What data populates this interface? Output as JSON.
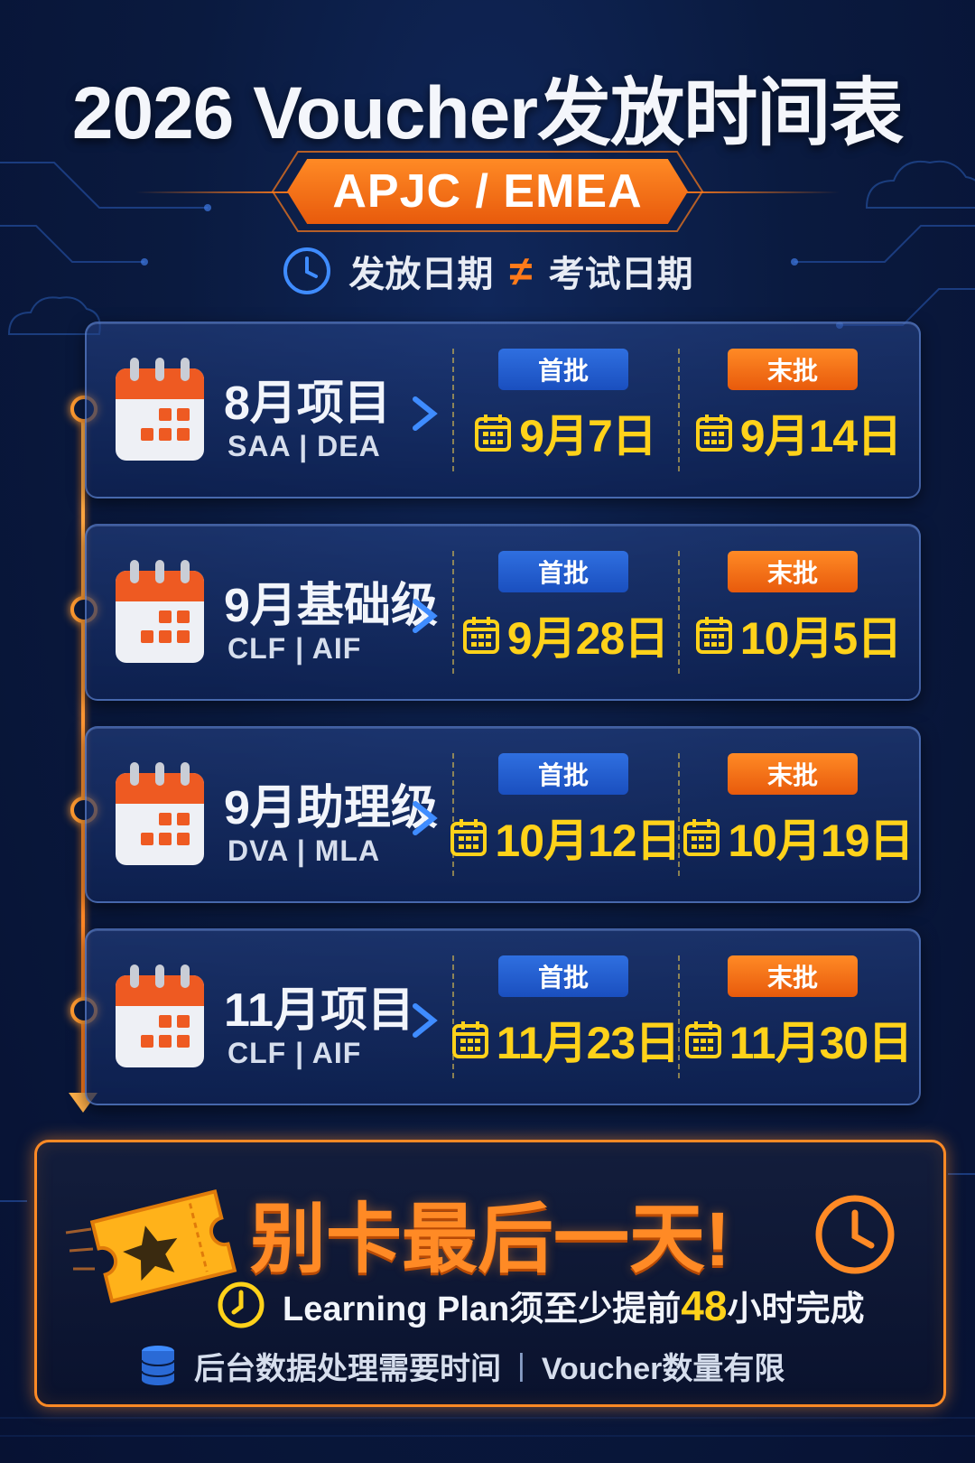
{
  "title": "2026 Voucher发放时间表",
  "region": "APJC / EMEA",
  "notice": {
    "left": "发放日期",
    "symbol": "≠",
    "right": "考试日期"
  },
  "schedule_labels": {
    "first": "首批",
    "last": "末批"
  },
  "schedule": [
    {
      "name": "8月项目",
      "exams": "SAA  |  DEA",
      "first_date": "9月7日",
      "last_date": "9月14日"
    },
    {
      "name": "9月基础级",
      "exams": "CLF  |  AIF",
      "first_date": "9月28日",
      "last_date": "10月5日"
    },
    {
      "name": "9月助理级",
      "exams": "DVA  |  MLA",
      "first_date": "10月12日",
      "last_date": "10月19日"
    },
    {
      "name": "11月项目",
      "exams": "CLF  |  AIF",
      "first_date": "11月23日",
      "last_date": "11月30日"
    }
  ],
  "reminder": {
    "headline": "别卡最后一天!",
    "lp_prefix": "Learning Plan须至少提前",
    "lp_hours": "48",
    "lp_suffix": "小时完成",
    "footer_left": "后台数据处理需要时间",
    "footer_sep": "|",
    "footer_right": "Voucher数量有限"
  },
  "icons": {
    "notice": "clock-icon",
    "project": "calendar-icon",
    "date": "calendar-small-icon",
    "ticket": "ticket-star-icon",
    "alarm": "alarm-clock-icon",
    "database": "database-icon"
  },
  "colors": {
    "accent": "#ff8a25",
    "date": "#ffd21a",
    "first_badge": "#2f6fe0",
    "last_badge": "#e85a0c",
    "background": "#0a1a3f"
  }
}
